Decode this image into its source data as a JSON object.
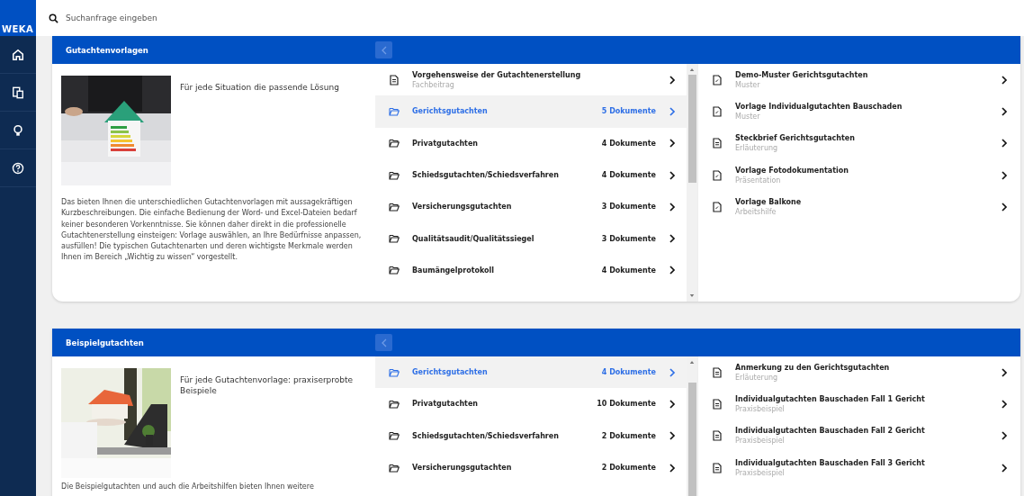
{
  "logo": "WEKA",
  "search": {
    "placeholder": "Suchanfrage eingeben"
  },
  "nav": [
    {
      "kind": "home"
    },
    {
      "kind": "documents"
    },
    {
      "kind": "idea"
    },
    {
      "kind": "help"
    }
  ],
  "sections": [
    {
      "title": "Gutachtenvorlagen",
      "picture": {
        "kind": "picture"
      },
      "tagline": "Für jede Situation die passende Lösung",
      "text": "Das bieten Ihnen die unterschiedlichen Gutachtenvorlagen mit aussagekräftigen Kurzbeschreibungen. Die einfache Bedienung der Word- und Excel-Dateien bedarf keiner besonderen Vorkenntnisse. Sie können daher direkt in die professionelle Gutachtenerstellung einsteigen: Vorlage auswählen, an Ihre Bedürfnisse anpassen, ausfüllen! Die typischen Gutachtenarten und deren wichtigste Merkmale werden Ihnen im Bereich „Wichtig zu wissen“ vorgestellt.",
      "list": [
        {
          "kind": "document",
          "title": "Vorgehensweise der Gutachtenerstellung",
          "subtitle": "Fachbeitrag"
        },
        {
          "kind": "folder",
          "title": "Gerichtsgutachten",
          "count": "5 Dokumente",
          "selected": true
        },
        {
          "kind": "folder",
          "title": "Privatgutachten",
          "count": "4 Dokumente",
          "selected": false
        },
        {
          "kind": "folder",
          "title": "Schiedsgutachten/Schiedsverfahren",
          "count": "4 Dokumente",
          "selected": false
        },
        {
          "kind": "folder",
          "title": "Versicherungsgutachten",
          "count": "3 Dokumente",
          "selected": false
        },
        {
          "kind": "folder",
          "title": "Qualitätsaudit/Qualitätssiegel",
          "count": "3 Dokumente",
          "selected": false
        },
        {
          "kind": "folder",
          "title": "Baumängelprotokoll",
          "count": "4 Dokumente",
          "selected": false
        }
      ],
      "documents": [
        {
          "kind": "template",
          "title": "Demo-Muster Gerichtsgutachten",
          "subtitle": "Muster"
        },
        {
          "kind": "template",
          "title": "Vorlage Individualgutachten Bauschaden",
          "subtitle": "Muster"
        },
        {
          "kind": "text",
          "title": "Steckbrief Gerichtsgutachten",
          "subtitle": "Erläuterung"
        },
        {
          "kind": "template",
          "title": "Vorlage Fotodokumentation",
          "subtitle": "Präsentation"
        },
        {
          "kind": "template",
          "title": "Vorlage Balkone",
          "subtitle": "Arbeitshilfe"
        }
      ]
    },
    {
      "title": "Beispielgutachten",
      "picture": {
        "kind": "picture"
      },
      "tagline": "Für jede Gutachtenvorlage: praxiserprobte Beispiele",
      "text": "Die Beispielgutachten und auch die Arbeitshilfen bieten Ihnen weitere",
      "list": [
        {
          "kind": "folder",
          "title": "Gerichtsgutachten",
          "count": "4 Dokumente",
          "selected": true
        },
        {
          "kind": "folder",
          "title": "Privatgutachten",
          "count": "10 Dokumente",
          "selected": false
        },
        {
          "kind": "folder",
          "title": "Schiedsgutachten/Schiedsverfahren",
          "count": "2 Dokumente",
          "selected": false
        },
        {
          "kind": "folder",
          "title": "Versicherungsgutachten",
          "count": "2 Dokumente",
          "selected": false
        }
      ],
      "documents": [
        {
          "kind": "text",
          "title": "Anmerkung zu den Gerichtsgutachten",
          "subtitle": "Erläuterung"
        },
        {
          "kind": "text",
          "title": "Individualgutachten Bauschaden Fall 1 Gericht",
          "subtitle": "Praxisbeispiel"
        },
        {
          "kind": "text",
          "title": "Individualgutachten Bauschaden Fall 2 Gericht",
          "subtitle": "Praxisbeispiel"
        },
        {
          "kind": "text",
          "title": "Individualgutachten Bauschaden Fall 3 Gericht",
          "subtitle": "Praxisbeispiel"
        }
      ]
    }
  ]
}
